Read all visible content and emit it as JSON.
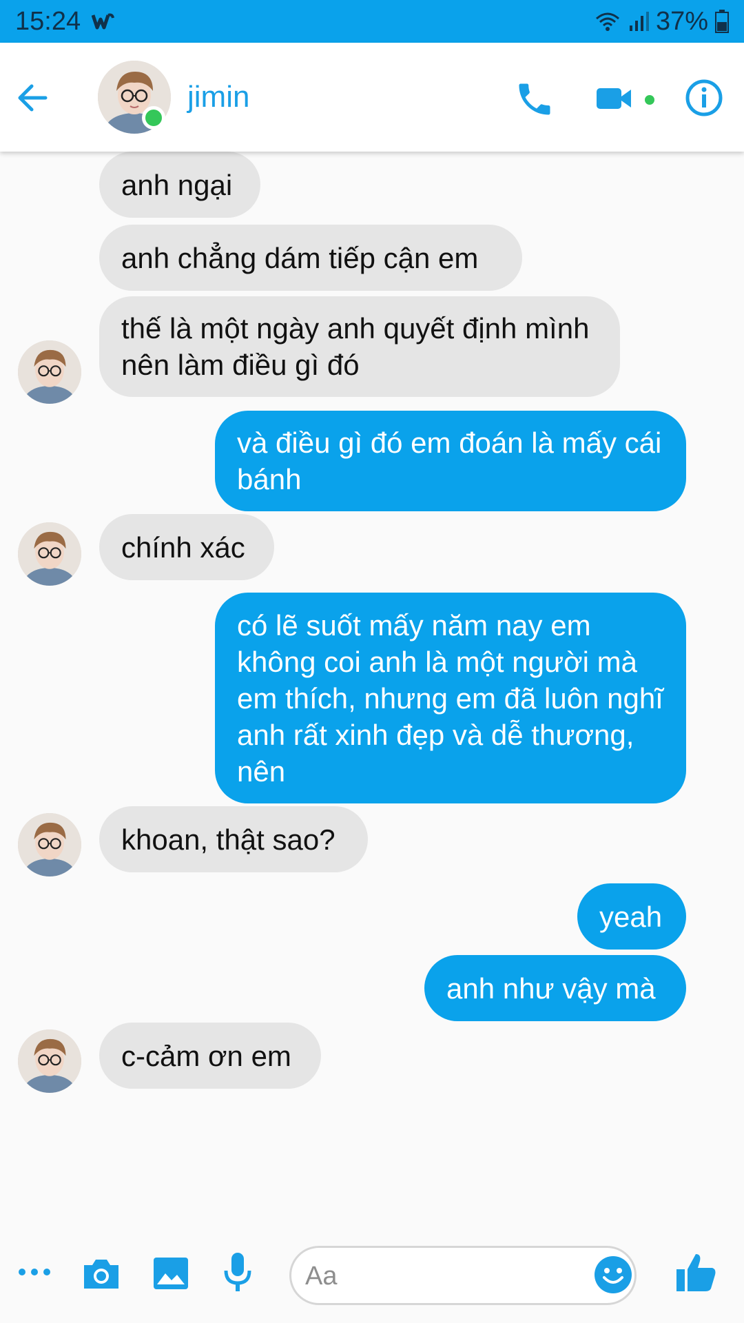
{
  "status_bar": {
    "time": "15:24",
    "battery": "37%"
  },
  "header": {
    "contact_name": "jimin"
  },
  "messages": [
    {
      "side": "in",
      "text": "anh ngại"
    },
    {
      "side": "in",
      "text": "anh chẳng dám tiếp cận em"
    },
    {
      "side": "in",
      "text": "thế là một ngày anh quyết định mình nên làm điều gì đó"
    },
    {
      "side": "out",
      "text": "và điều gì đó em đoán là mấy cái bánh"
    },
    {
      "side": "in",
      "text": "chính xác"
    },
    {
      "side": "out",
      "text": "có lẽ suốt mấy năm nay em không coi anh là một người mà em thích, nhưng em đã luôn nghĩ anh rất xinh đẹp và dễ thương, nên"
    },
    {
      "side": "in",
      "text": "khoan, thật sao?"
    },
    {
      "side": "out",
      "text": "yeah"
    },
    {
      "side": "out",
      "text": "anh như vậy mà"
    },
    {
      "side": "in",
      "text": "c-cảm ơn em"
    }
  ],
  "composer": {
    "placeholder": "Aa"
  },
  "colors": {
    "accent": "#0aa2eb",
    "incoming_bubble": "#e5e5e5",
    "online": "#34c759"
  },
  "icons": [
    "wattpad-icon",
    "wifi-icon",
    "signal-icon",
    "battery-icon",
    "back-arrow-icon",
    "phone-icon",
    "video-camera-icon",
    "info-icon",
    "more-icon",
    "camera-icon",
    "image-icon",
    "microphone-icon",
    "emoji-icon",
    "thumbs-up-icon"
  ]
}
